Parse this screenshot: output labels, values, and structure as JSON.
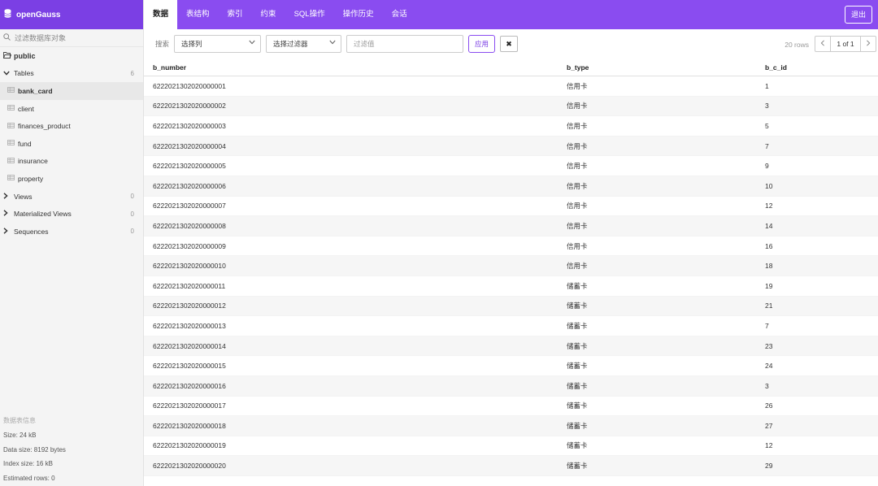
{
  "brand": {
    "name": "openGauss",
    "icon": "database-icon"
  },
  "sidebar": {
    "search_placeholder": "过滤数据库对象",
    "schema": "public",
    "tables_label": "Tables",
    "tables_count": "6",
    "tables": [
      "bank_card",
      "client",
      "finances_product",
      "fund",
      "insurance",
      "property"
    ],
    "active_table": "bank_card",
    "views_label": "Views",
    "views_count": "0",
    "matviews_label": "Materialized Views",
    "matviews_count": "0",
    "sequences_label": "Sequences",
    "sequences_count": "0"
  },
  "db_info": {
    "heading": "数据表信息",
    "size": "Size: 24 kB",
    "data_size": "Data size: 8192 bytes",
    "index_size": "Index size: 16 kB",
    "estimated_rows": "Estimated rows: 0"
  },
  "nav": {
    "tabs": [
      "数据",
      "表结构",
      "索引",
      "约束",
      "SQL操作",
      "操作历史",
      "会话"
    ],
    "active_tab": "数据",
    "logout": "退出"
  },
  "toolbar": {
    "search_label": "搜索",
    "select_column": "选择列",
    "select_filter": "选择过滤器",
    "filter_placeholder": "过滤值",
    "apply": "应用",
    "clear": "✖",
    "rows_count": "20 rows",
    "page": "1 of 1"
  },
  "table": {
    "columns": [
      "b_number",
      "b_type",
      "b_c_id"
    ],
    "rows": [
      [
        "6222021302020000001",
        "信用卡",
        "1"
      ],
      [
        "6222021302020000002",
        "信用卡",
        "3"
      ],
      [
        "6222021302020000003",
        "信用卡",
        "5"
      ],
      [
        "6222021302020000004",
        "信用卡",
        "7"
      ],
      [
        "6222021302020000005",
        "信用卡",
        "9"
      ],
      [
        "6222021302020000006",
        "信用卡",
        "10"
      ],
      [
        "6222021302020000007",
        "信用卡",
        "12"
      ],
      [
        "6222021302020000008",
        "信用卡",
        "14"
      ],
      [
        "6222021302020000009",
        "信用卡",
        "16"
      ],
      [
        "6222021302020000010",
        "信用卡",
        "18"
      ],
      [
        "6222021302020000011",
        "储蓄卡",
        "19"
      ],
      [
        "6222021302020000012",
        "储蓄卡",
        "21"
      ],
      [
        "6222021302020000013",
        "储蓄卡",
        "7"
      ],
      [
        "6222021302020000014",
        "储蓄卡",
        "23"
      ],
      [
        "6222021302020000015",
        "储蓄卡",
        "24"
      ],
      [
        "6222021302020000016",
        "储蓄卡",
        "3"
      ],
      [
        "6222021302020000017",
        "储蓄卡",
        "26"
      ],
      [
        "6222021302020000018",
        "储蓄卡",
        "27"
      ],
      [
        "6222021302020000019",
        "储蓄卡",
        "12"
      ],
      [
        "6222021302020000020",
        "储蓄卡",
        "29"
      ]
    ]
  },
  "colors": {
    "brand": "#7b3fe4",
    "nav": "#8a4cf0",
    "sidebar_bg": "#f4f4f4"
  }
}
